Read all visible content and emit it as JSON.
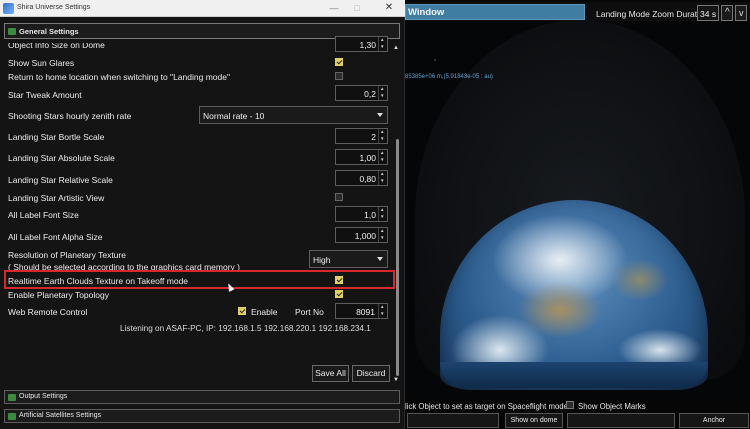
{
  "window": {
    "title": "Shira Universe Settings",
    "minimize_glyph": "—",
    "maximize_glyph": "□",
    "close_glyph": "✕"
  },
  "sections": {
    "general": "General Settings",
    "output": "Output Settings",
    "satellites": "Artificial Satellites Settings"
  },
  "settings": {
    "object_info_size": {
      "label": "Object Info Size on Dome",
      "value": "1,30"
    },
    "show_sun_glares": {
      "label": "Show Sun Glares",
      "checked": true
    },
    "return_home": {
      "label": "Return to home location when switching to \"Landing mode\"",
      "checked": false
    },
    "star_tweak": {
      "label": "Star Tweak Amount",
      "value": "0,2"
    },
    "shooting_stars": {
      "label": "Shooting Stars hourly zenith rate",
      "value": "Normal rate - 10"
    },
    "bortle": {
      "label": "Landing Star Bortle Scale",
      "value": "2"
    },
    "abs_scale": {
      "label": "Landing Star Absolute Scale",
      "value": "1,00"
    },
    "rel_scale": {
      "label": "Landing Star Relative Scale",
      "value": "0,80"
    },
    "artistic": {
      "label": "Landing Star Artistic View",
      "checked": false
    },
    "label_font_size": {
      "label": "All Label Font Size",
      "value": "1,0"
    },
    "label_font_alpha": {
      "label": "All Label Font Alpha Size",
      "value": "1,000"
    },
    "planet_texture": {
      "label": "Resolution of Planetary Texture",
      "sublabel": "( Should be selected according to the graphics card memory )",
      "value": "High"
    },
    "clouds_texture": {
      "label": "Realtime Earth Clouds Texture on Takeoff mode",
      "checked": true
    },
    "topology": {
      "label": "Enable Planetary Topology",
      "checked": true
    },
    "web_remote": {
      "label": "Web Remote Control",
      "enable_label": "Enable",
      "enabled": true,
      "port_label": "Port No",
      "port": "8091"
    },
    "listening": "Listening on ASAF-PC, IP: 192.168.1.5 192.168.220.1 192.168.234.1"
  },
  "buttons": {
    "save_all": "Save All",
    "discard": "Discard"
  },
  "viewport": {
    "window_tab": "Window",
    "zoom_label": "Landing Mode Zoom Duration",
    "zoom_value": "34 s",
    "coord_readout": "85385e+06 m,(5.91843e-05 : au)",
    "select_hint": "lick Object to set as target on Spaceflight mode",
    "show_marks_label": "Show Object Marks",
    "show_on_dome": "Show on dome",
    "anchor": "Anchor"
  },
  "colors": {
    "accent_check": "#e1d068",
    "highlight_border": "#d62a2a",
    "window_tab": "#3f7da3",
    "coord_text": "#5fa3d2"
  },
  "icons": {
    "section_icon": "settings-panel-icon",
    "app_icon": "shira-app-icon"
  }
}
